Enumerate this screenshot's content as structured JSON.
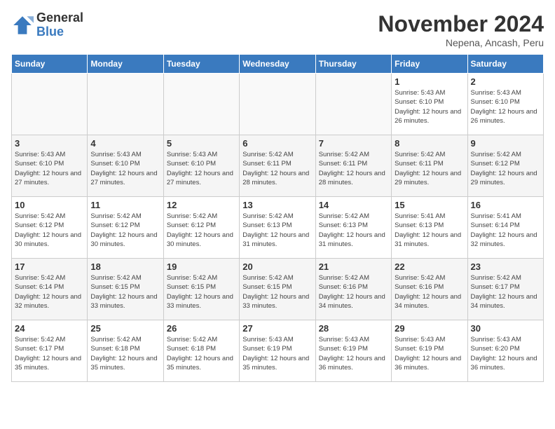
{
  "header": {
    "logo_general": "General",
    "logo_blue": "Blue",
    "month_title": "November 2024",
    "location": "Nepena, Ancash, Peru"
  },
  "days_of_week": [
    "Sunday",
    "Monday",
    "Tuesday",
    "Wednesday",
    "Thursday",
    "Friday",
    "Saturday"
  ],
  "weeks": [
    [
      {
        "day": "",
        "info": ""
      },
      {
        "day": "",
        "info": ""
      },
      {
        "day": "",
        "info": ""
      },
      {
        "day": "",
        "info": ""
      },
      {
        "day": "",
        "info": ""
      },
      {
        "day": "1",
        "info": "Sunrise: 5:43 AM\nSunset: 6:10 PM\nDaylight: 12 hours and 26 minutes."
      },
      {
        "day": "2",
        "info": "Sunrise: 5:43 AM\nSunset: 6:10 PM\nDaylight: 12 hours and 26 minutes."
      }
    ],
    [
      {
        "day": "3",
        "info": "Sunrise: 5:43 AM\nSunset: 6:10 PM\nDaylight: 12 hours and 27 minutes."
      },
      {
        "day": "4",
        "info": "Sunrise: 5:43 AM\nSunset: 6:10 PM\nDaylight: 12 hours and 27 minutes."
      },
      {
        "day": "5",
        "info": "Sunrise: 5:43 AM\nSunset: 6:10 PM\nDaylight: 12 hours and 27 minutes."
      },
      {
        "day": "6",
        "info": "Sunrise: 5:42 AM\nSunset: 6:11 PM\nDaylight: 12 hours and 28 minutes."
      },
      {
        "day": "7",
        "info": "Sunrise: 5:42 AM\nSunset: 6:11 PM\nDaylight: 12 hours and 28 minutes."
      },
      {
        "day": "8",
        "info": "Sunrise: 5:42 AM\nSunset: 6:11 PM\nDaylight: 12 hours and 29 minutes."
      },
      {
        "day": "9",
        "info": "Sunrise: 5:42 AM\nSunset: 6:12 PM\nDaylight: 12 hours and 29 minutes."
      }
    ],
    [
      {
        "day": "10",
        "info": "Sunrise: 5:42 AM\nSunset: 6:12 PM\nDaylight: 12 hours and 30 minutes."
      },
      {
        "day": "11",
        "info": "Sunrise: 5:42 AM\nSunset: 6:12 PM\nDaylight: 12 hours and 30 minutes."
      },
      {
        "day": "12",
        "info": "Sunrise: 5:42 AM\nSunset: 6:12 PM\nDaylight: 12 hours and 30 minutes."
      },
      {
        "day": "13",
        "info": "Sunrise: 5:42 AM\nSunset: 6:13 PM\nDaylight: 12 hours and 31 minutes."
      },
      {
        "day": "14",
        "info": "Sunrise: 5:42 AM\nSunset: 6:13 PM\nDaylight: 12 hours and 31 minutes."
      },
      {
        "day": "15",
        "info": "Sunrise: 5:41 AM\nSunset: 6:13 PM\nDaylight: 12 hours and 31 minutes."
      },
      {
        "day": "16",
        "info": "Sunrise: 5:41 AM\nSunset: 6:14 PM\nDaylight: 12 hours and 32 minutes."
      }
    ],
    [
      {
        "day": "17",
        "info": "Sunrise: 5:42 AM\nSunset: 6:14 PM\nDaylight: 12 hours and 32 minutes."
      },
      {
        "day": "18",
        "info": "Sunrise: 5:42 AM\nSunset: 6:15 PM\nDaylight: 12 hours and 33 minutes."
      },
      {
        "day": "19",
        "info": "Sunrise: 5:42 AM\nSunset: 6:15 PM\nDaylight: 12 hours and 33 minutes."
      },
      {
        "day": "20",
        "info": "Sunrise: 5:42 AM\nSunset: 6:15 PM\nDaylight: 12 hours and 33 minutes."
      },
      {
        "day": "21",
        "info": "Sunrise: 5:42 AM\nSunset: 6:16 PM\nDaylight: 12 hours and 34 minutes."
      },
      {
        "day": "22",
        "info": "Sunrise: 5:42 AM\nSunset: 6:16 PM\nDaylight: 12 hours and 34 minutes."
      },
      {
        "day": "23",
        "info": "Sunrise: 5:42 AM\nSunset: 6:17 PM\nDaylight: 12 hours and 34 minutes."
      }
    ],
    [
      {
        "day": "24",
        "info": "Sunrise: 5:42 AM\nSunset: 6:17 PM\nDaylight: 12 hours and 35 minutes."
      },
      {
        "day": "25",
        "info": "Sunrise: 5:42 AM\nSunset: 6:18 PM\nDaylight: 12 hours and 35 minutes."
      },
      {
        "day": "26",
        "info": "Sunrise: 5:42 AM\nSunset: 6:18 PM\nDaylight: 12 hours and 35 minutes."
      },
      {
        "day": "27",
        "info": "Sunrise: 5:43 AM\nSunset: 6:19 PM\nDaylight: 12 hours and 35 minutes."
      },
      {
        "day": "28",
        "info": "Sunrise: 5:43 AM\nSunset: 6:19 PM\nDaylight: 12 hours and 36 minutes."
      },
      {
        "day": "29",
        "info": "Sunrise: 5:43 AM\nSunset: 6:19 PM\nDaylight: 12 hours and 36 minutes."
      },
      {
        "day": "30",
        "info": "Sunrise: 5:43 AM\nSunset: 6:20 PM\nDaylight: 12 hours and 36 minutes."
      }
    ]
  ]
}
